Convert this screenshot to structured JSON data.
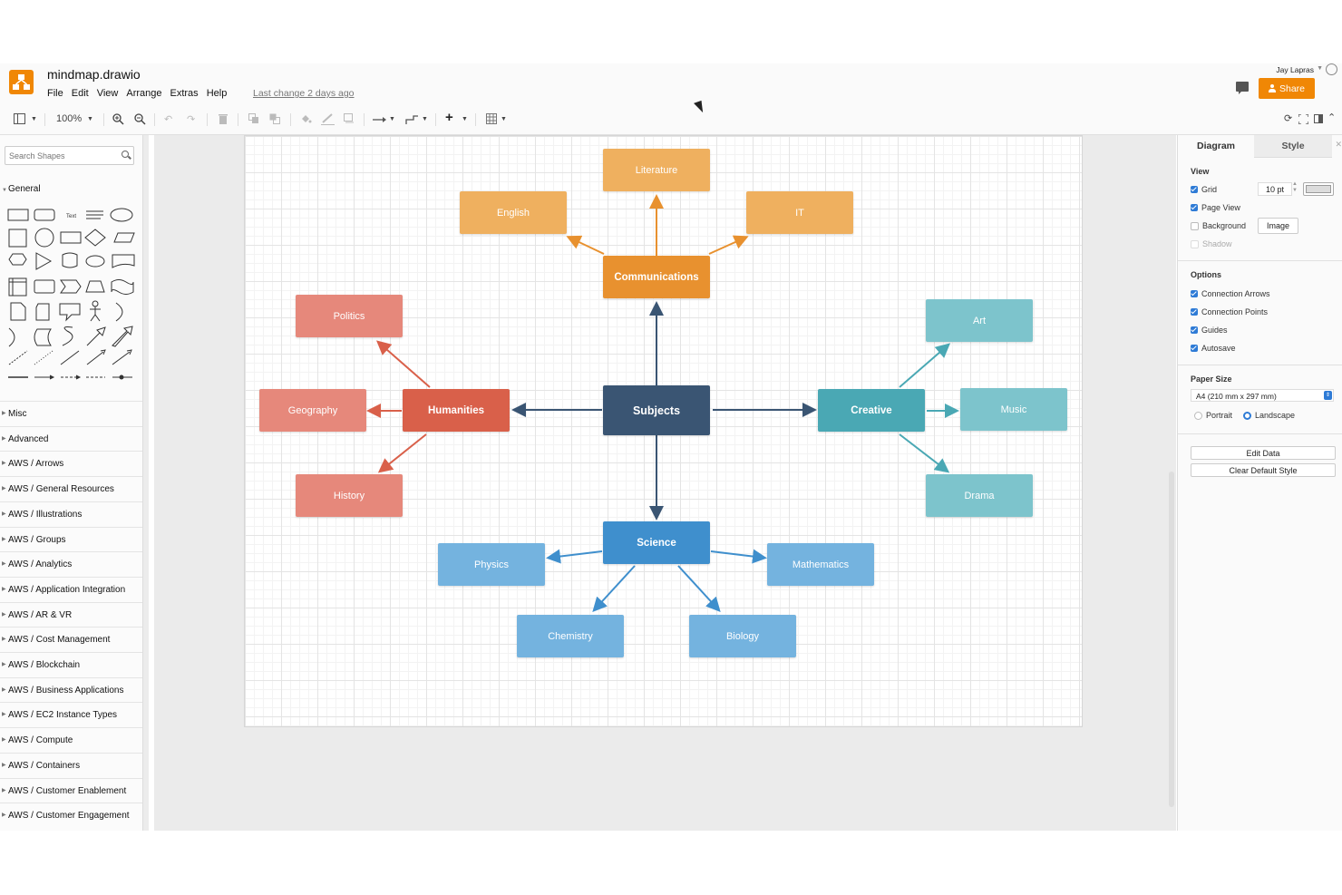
{
  "app": {
    "file_title": "mindmap.drawio",
    "menus": [
      "File",
      "Edit",
      "View",
      "Arrange",
      "Extras",
      "Help"
    ],
    "last_change": "Last change 2 days ago",
    "user_name": "Jay Lapras",
    "share_label": "Share",
    "brand_color": "#f08705"
  },
  "toolbar": {
    "zoom": "100%",
    "icons": [
      "format-panel-icon",
      "zoom-in-icon",
      "zoom-out-icon",
      "undo-icon",
      "redo-icon",
      "delete-icon",
      "to-front-icon",
      "to-back-icon",
      "fill-color-icon",
      "line-color-icon",
      "shadow-icon",
      "connection-icon",
      "waypoints-icon",
      "insert-icon",
      "table-icon",
      "refresh-icon",
      "fullscreen-icon",
      "format-icon",
      "collapse-icon"
    ]
  },
  "sidebar": {
    "search_placeholder": "Search Shapes",
    "general_label": "General",
    "text_shape_label": "Text",
    "sections": [
      "Misc",
      "Advanced",
      "AWS / Arrows",
      "AWS / General Resources",
      "AWS / Illustrations",
      "AWS / Groups",
      "AWS / Analytics",
      "AWS / Application Integration",
      "AWS / AR & VR",
      "AWS / Cost Management",
      "AWS / Blockchain",
      "AWS / Business Applications",
      "AWS / EC2 Instance Types",
      "AWS / Compute",
      "AWS / Containers",
      "AWS / Customer Enablement",
      "AWS / Customer Engagement"
    ]
  },
  "diagram": {
    "nodes": {
      "subjects": "Subjects",
      "communications": "Communications",
      "literature": "Literature",
      "english": "English",
      "it": "IT",
      "humanities": "Humanities",
      "politics": "Politics",
      "geography": "Geography",
      "history": "History",
      "creative": "Creative",
      "art": "Art",
      "music": "Music",
      "drama": "Drama",
      "science": "Science",
      "physics": "Physics",
      "mathematics": "Mathematics",
      "chemistry": "Chemistry",
      "biology": "Biology"
    },
    "colors": {
      "subjects": "#3a5573",
      "communications": "#e8912f",
      "communications_child": "#efb05f",
      "humanities": "#d9604a",
      "humanities_child": "#e6887b",
      "creative": "#4aa8b4",
      "creative_child": "#7dc4cc",
      "science": "#3f8fcd",
      "science_child": "#74b3df"
    }
  },
  "panel": {
    "tab_diagram": "Diagram",
    "tab_style": "Style",
    "view_label": "View",
    "grid_label": "Grid",
    "grid_size": "10 pt",
    "page_view_label": "Page View",
    "background_label": "Background",
    "image_button": "Image",
    "shadow_label": "Shadow",
    "options_label": "Options",
    "connection_arrows": "Connection Arrows",
    "connection_points": "Connection Points",
    "guides": "Guides",
    "autosave": "Autosave",
    "paper_size_label": "Paper Size",
    "paper_size_value": "A4 (210 mm x 297 mm)",
    "portrait": "Portrait",
    "landscape": "Landscape",
    "edit_data": "Edit Data",
    "clear_default_style": "Clear Default Style",
    "accent": "#2e7bd6"
  }
}
